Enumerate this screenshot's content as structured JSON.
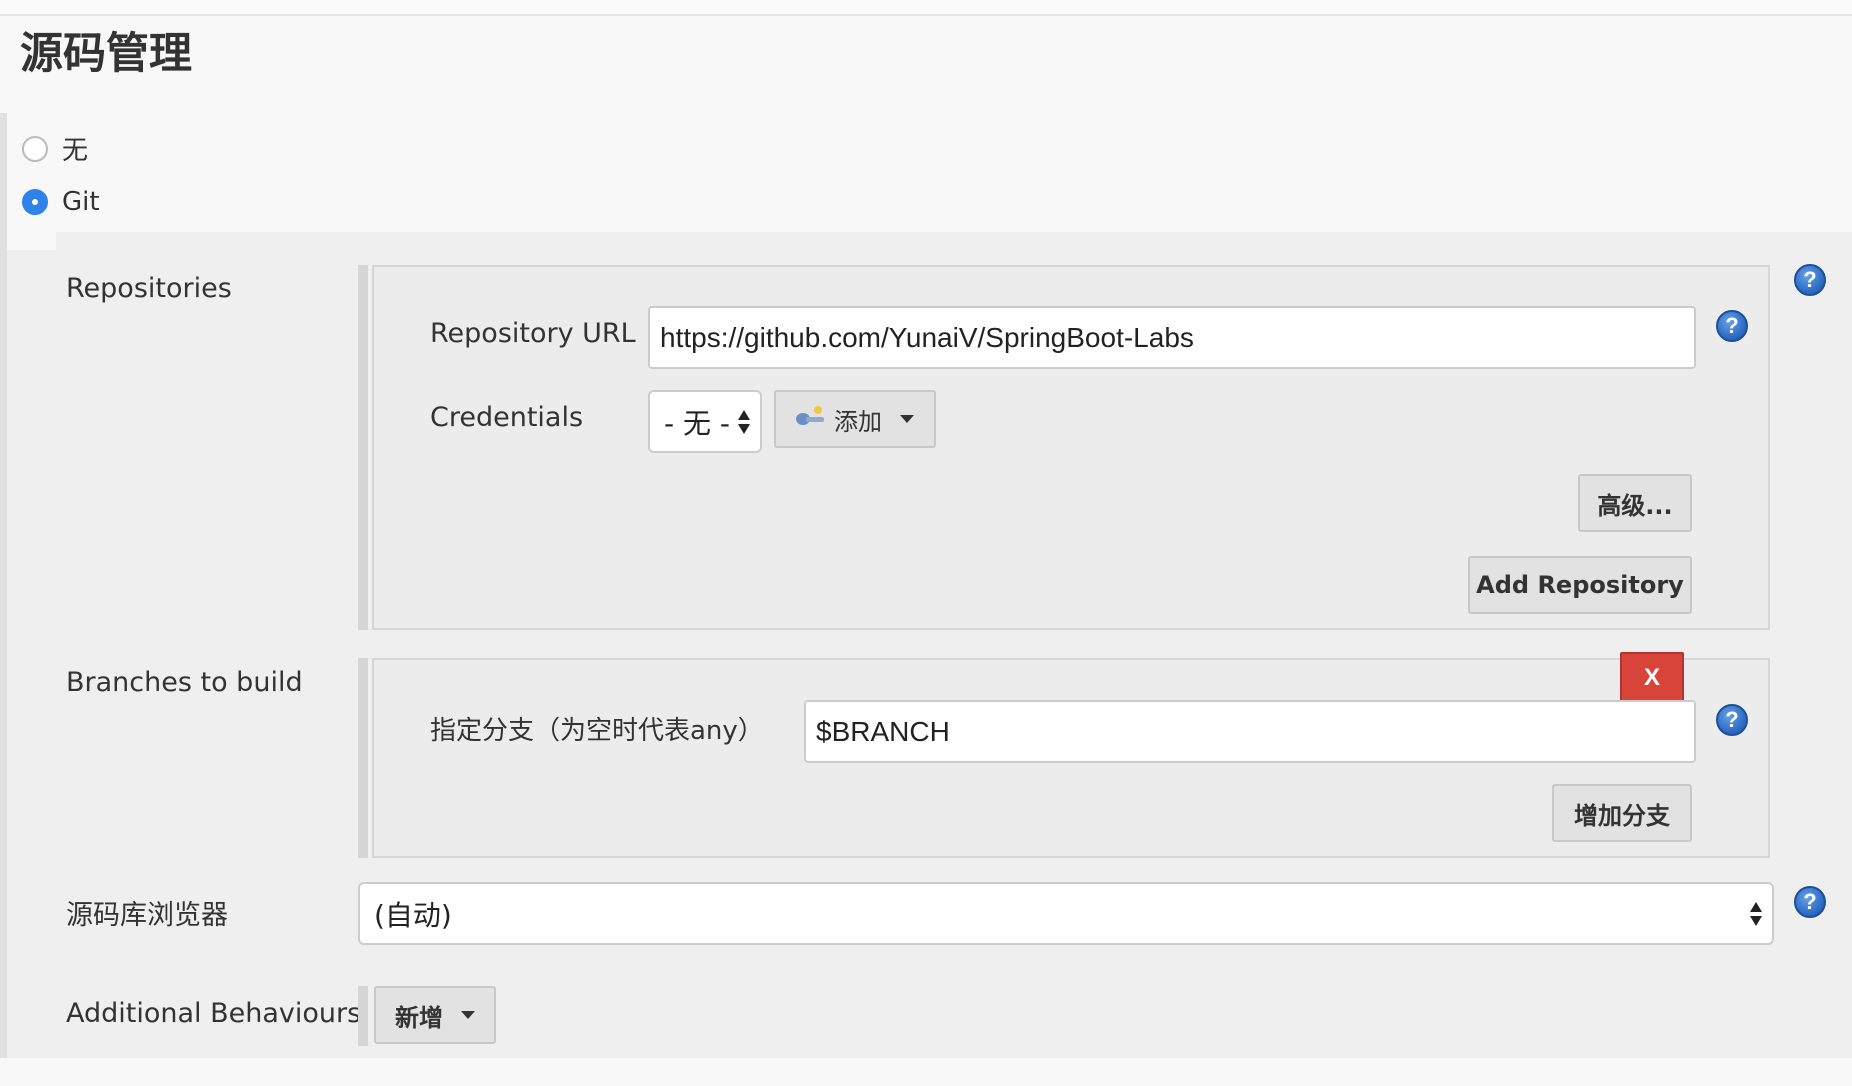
{
  "section": {
    "title": "源码管理"
  },
  "scm_options": [
    {
      "label": "无",
      "checked": false
    },
    {
      "label": "Git",
      "checked": true
    }
  ],
  "repositories": {
    "label": "Repositories",
    "url_label": "Repository URL",
    "url_value": "https://github.com/YunaiV/SpringBoot-Labs",
    "credentials_label": "Credentials",
    "credentials_value": "- 无 -",
    "add_label": "添加",
    "advanced_label": "高级...",
    "add_repository_label": "Add Repository"
  },
  "branches": {
    "label": "Branches to build",
    "delete_label": "X",
    "branch_spec_label": "指定分支（为空时代表any）",
    "branch_spec_value": "$BRANCH",
    "add_branch_label": "增加分支"
  },
  "repo_browser": {
    "label": "源码库浏览器",
    "value": "(自动)"
  },
  "additional_behaviours": {
    "label": "Additional Behaviours",
    "add_label": "新增"
  },
  "help_glyph": "?",
  "icons": [
    "help-icon",
    "key-icon",
    "chevron-down-icon",
    "select-arrows-icon"
  ],
  "colors": {
    "accent": "#2f83e8",
    "danger": "#d9443a",
    "help": "#2f6fc7"
  }
}
